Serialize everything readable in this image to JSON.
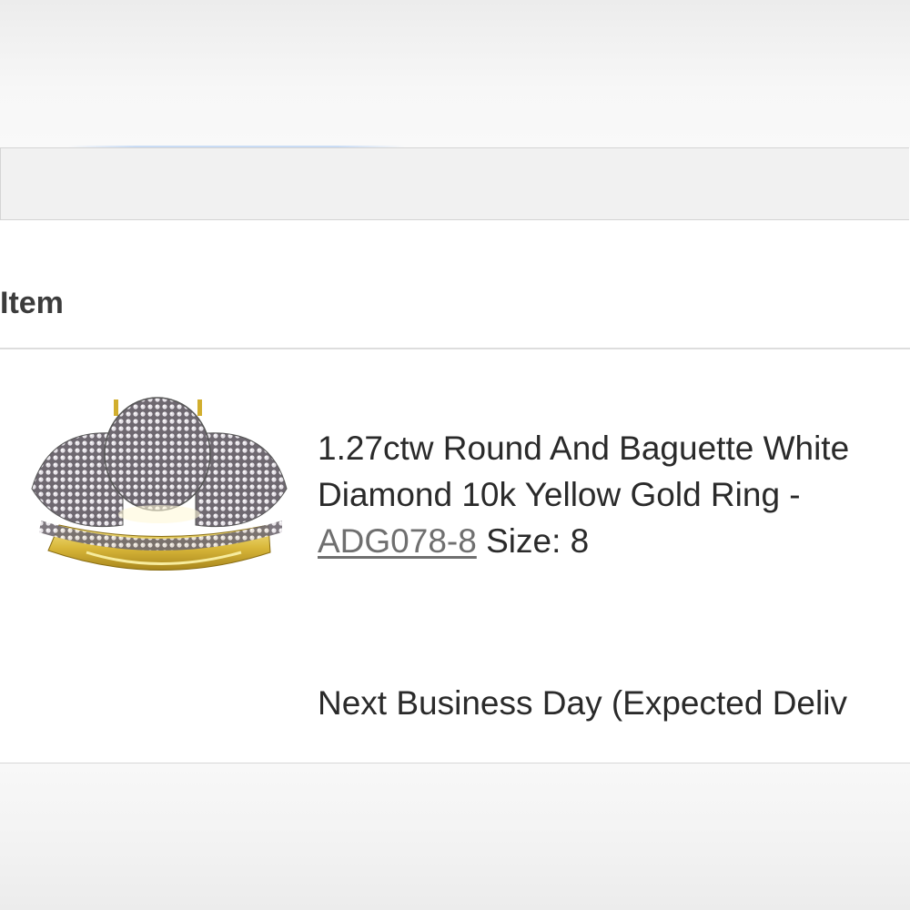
{
  "order_item": {
    "header": "Item",
    "title_text": "1.27ctw Round And Baguette White Diamond 10k Yellow Gold Ring - ",
    "sku": "ADG078-8",
    "size_text": " Size: 8",
    "shipping": "Next Business Day (Expected Deliv",
    "image_icon": "diamond-ring-icon"
  }
}
